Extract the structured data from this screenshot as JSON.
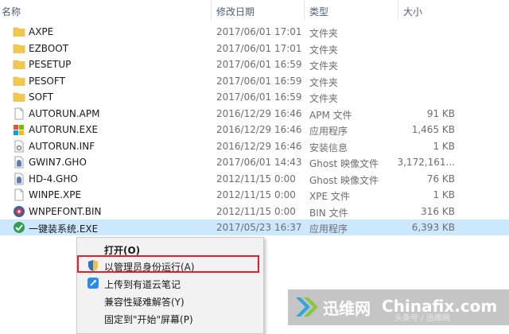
{
  "columns": {
    "name": "名称",
    "date": "修改日期",
    "type": "类型",
    "size": "大小"
  },
  "files": [
    {
      "name": "AXPE",
      "date": "2017/06/01 17:01",
      "type": "文件夹",
      "size": "",
      "icon": "folder-icon"
    },
    {
      "name": "EZBOOT",
      "date": "2017/06/01 17:01",
      "type": "文件夹",
      "size": "",
      "icon": "folder-icon"
    },
    {
      "name": "PESETUP",
      "date": "2017/06/01 16:59",
      "type": "文件夹",
      "size": "",
      "icon": "folder-icon"
    },
    {
      "name": "PESOFT",
      "date": "2017/06/01 16:59",
      "type": "文件夹",
      "size": "",
      "icon": "folder-icon"
    },
    {
      "name": "SOFT",
      "date": "2017/06/01 16:59",
      "type": "文件夹",
      "size": "",
      "icon": "folder-icon"
    },
    {
      "name": "AUTORUN.APM",
      "date": "2016/12/29 16:46",
      "type": "APM 文件",
      "size": "91 KB",
      "icon": "file-icon"
    },
    {
      "name": "AUTORUN.EXE",
      "date": "2016/12/29 16:46",
      "type": "应用程序",
      "size": "1,465 KB",
      "icon": "exe-icon"
    },
    {
      "name": "AUTORUN.INF",
      "date": "2016/12/29 16:46",
      "type": "安装信息",
      "size": "1 KB",
      "icon": "settings-file-icon"
    },
    {
      "name": "GWIN7.GHO",
      "date": "2017/06/01 14:43",
      "type": "Ghost 映像文件",
      "size": "3,172,161...",
      "icon": "ghost-icon"
    },
    {
      "name": "HD-4.GHO",
      "date": "2012/11/15 0:00",
      "type": "Ghost 映像文件",
      "size": "76 KB",
      "icon": "ghost-icon"
    },
    {
      "name": "WINPE.XPE",
      "date": "2012/11/15 0:00",
      "type": "XPE 文件",
      "size": "1 KB",
      "icon": "file-icon"
    },
    {
      "name": "WNPEFONT.BIN",
      "date": "2012/11/15 0:00",
      "type": "BIN 文件",
      "size": "316 KB",
      "icon": "bin-icon"
    },
    {
      "name": "一键装系统.EXE",
      "date": "2017/05/23 16:37",
      "type": "应用程序",
      "size": "6,393 KB",
      "icon": "installer-icon"
    }
  ],
  "context_menu": {
    "items": [
      {
        "label": "打开(O)",
        "icon": "",
        "bold": true
      },
      {
        "label": "以管理员身份运行(A)",
        "icon": "uac-shield-icon",
        "bold": false
      },
      {
        "label": "上传到有道云笔记",
        "icon": "youdao-note-icon",
        "bold": false
      },
      {
        "label": "兼容性疑难解答(Y)",
        "icon": "",
        "bold": false
      },
      {
        "label": "固定到\"开始\"屏幕(P)",
        "icon": "",
        "bold": false
      }
    ]
  },
  "watermark": {
    "brand_cn": "迅维网",
    "brand_en": "Chinafix.com",
    "sub": "头条号 / 迅维网"
  },
  "colors": {
    "selection": "#cce8ff",
    "highlight_border": "#e0202a",
    "folder": "#f4c84b",
    "header_text": "#4c607a"
  }
}
